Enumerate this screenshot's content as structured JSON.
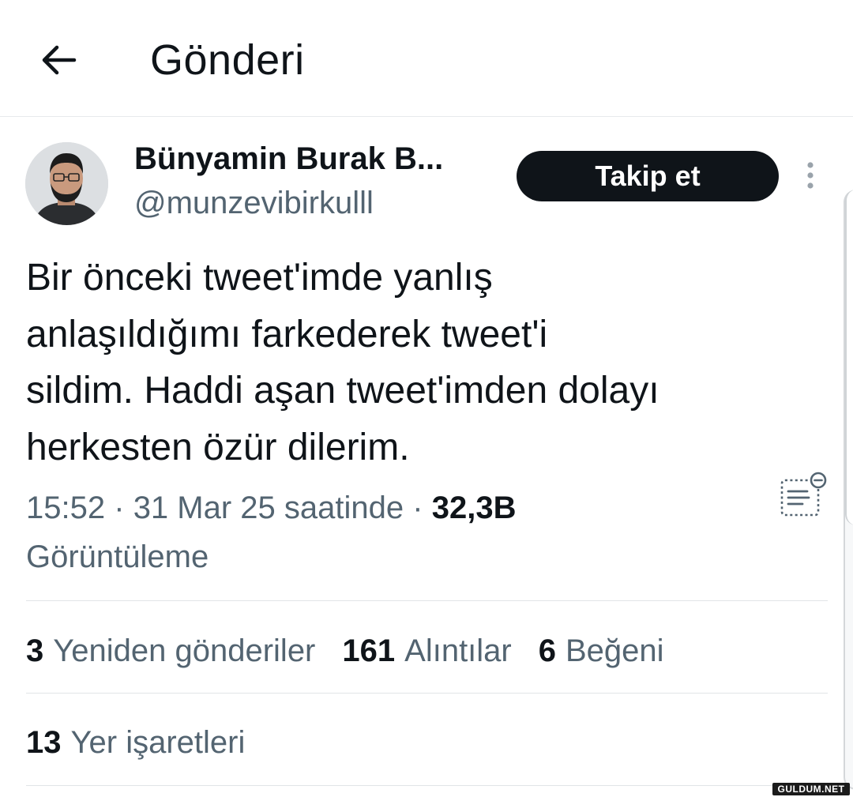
{
  "header": {
    "title": "Gönderi",
    "back_icon": "arrow-left-icon"
  },
  "post": {
    "author": {
      "display_name": "Bünyamin Burak B...",
      "handle": "@munzevibirkulll",
      "avatar_icon": "profile-photo"
    },
    "follow_label": "Takip et",
    "more_icon": "more-vertical-icon",
    "text_lines": [
      "Bir önceki tweet'imde yanlış",
      "anlaşıldığımı farkederek tweet'i",
      "sildim. Haddi aşan tweet'imden dolayı",
      "herkesten özür dilerim."
    ],
    "meta": {
      "time": "15:52",
      "separator": "·",
      "date": "31 Mar 25 saatinde",
      "views_count": "32,3B",
      "views_label": "Görüntüleme"
    },
    "notes_icon": "community-notes-icon",
    "stats": [
      {
        "count": "3",
        "label": "Yeniden gönderiler"
      },
      {
        "count": "161",
        "label": "Alıntılar"
      },
      {
        "count": "6",
        "label": "Beğeni"
      }
    ],
    "bookmarks": {
      "count": "13",
      "label": "Yer işaretleri"
    }
  },
  "watermark": {
    "text": "GULDUM.NET"
  },
  "colors": {
    "text_primary": "#0f1419",
    "text_secondary": "#536471",
    "divider": "#e1e4e7",
    "follow_bg": "#0f1419",
    "background": "#ffffff"
  }
}
